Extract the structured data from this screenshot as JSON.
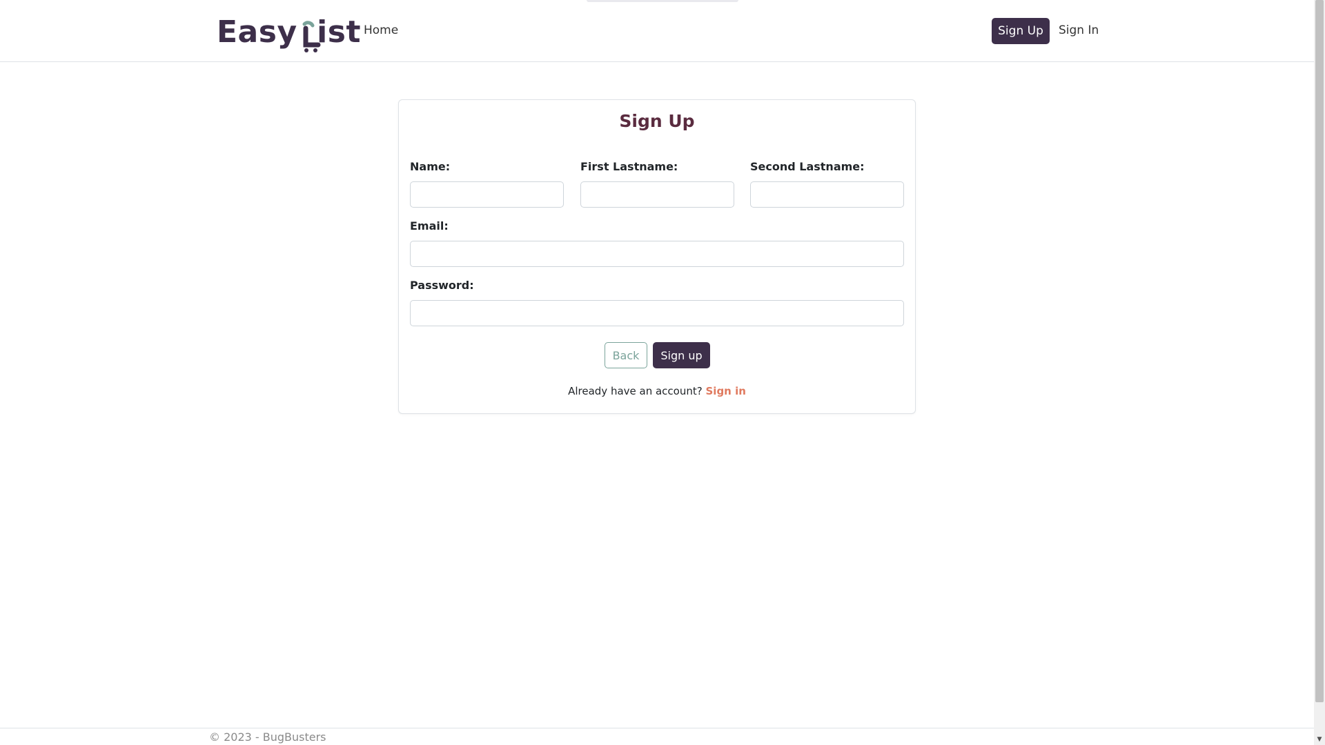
{
  "navbar": {
    "brand": {
      "text_before": "Easy",
      "text_l": "L",
      "text_after": "ist",
      "icon": "cart-icon"
    },
    "home_label": "Home",
    "signup_label": "Sign Up",
    "signin_label": "Sign In"
  },
  "form": {
    "title": "Sign Up",
    "fields": {
      "name": {
        "label": "Name:",
        "value": ""
      },
      "first_lastname": {
        "label": "First Lastname:",
        "value": ""
      },
      "second_lastname": {
        "label": "Second Lastname:",
        "value": ""
      },
      "email": {
        "label": "Email:",
        "value": ""
      },
      "password": {
        "label": "Password:",
        "value": ""
      }
    },
    "back_label": "Back",
    "submit_label": "Sign up",
    "already_text": "Already have an account?",
    "signin_link": "Sign in"
  },
  "footer": {
    "text": "© 2023 - BugBusters"
  },
  "colors": {
    "primary": "#3d2f4a",
    "title": "#5a2b3f",
    "accent_link": "#e07a5f",
    "back_outline": "#7aa39a"
  },
  "scrollbar": {
    "arrow_icon": "scroll-down-arrow-icon"
  }
}
